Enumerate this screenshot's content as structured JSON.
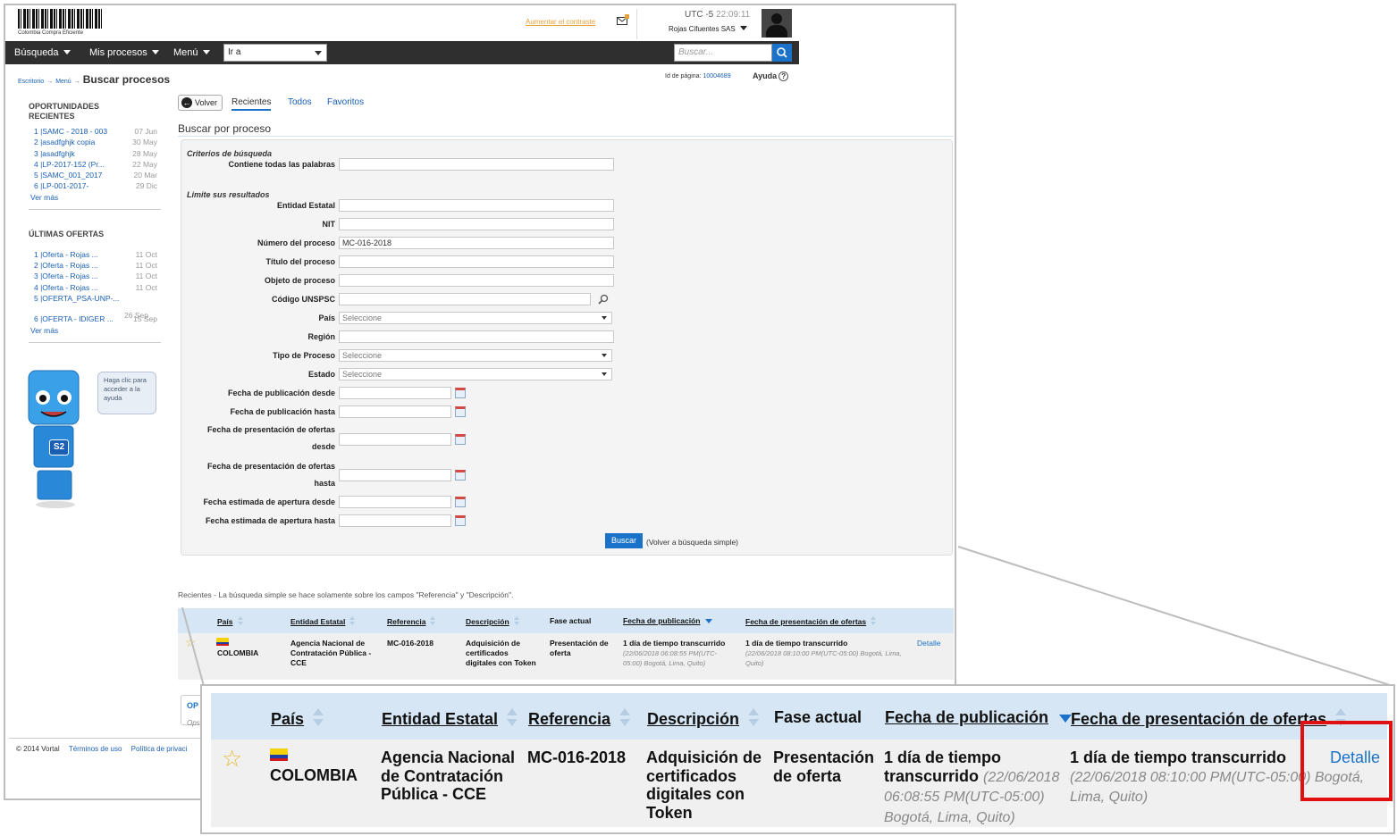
{
  "header": {
    "logo_caption": "Colombia Compra Eficiente",
    "contrast_link": "Aumentar el contraste",
    "timezone": "UTC -5",
    "time": "22:09:11",
    "company": "Rojas Cifuentes SAS"
  },
  "nav": {
    "busqueda": "Búsqueda",
    "mis_procesos": "Mis procesos",
    "menu": "Menú",
    "ir_a": "Ir a",
    "search_placeholder": "Buscar..."
  },
  "breadcrumb": {
    "escritorio": "Escritorio",
    "menu": "Menú",
    "current": "Buscar procesos",
    "page_id_label": "Id de página:",
    "page_id": "10004689",
    "help": "Ayuda",
    "help_icon": "?"
  },
  "sidebar": {
    "opportunities_title_1": "OPORTUNIDADES",
    "opportunities_title_2": "RECIENTES",
    "opportunities": [
      {
        "label": "1 |SAMC - 2018 - 003",
        "date": "07 Jun"
      },
      {
        "label": "2 |asadfghjk copia",
        "date": "30 May"
      },
      {
        "label": "3 |asadfghjk",
        "date": "28 May"
      },
      {
        "label": "4 |LP-2017-152 (Pr...",
        "date": "22 May"
      },
      {
        "label": "5 |SAMC_001_2017",
        "date": "20 Mar"
      },
      {
        "label": "6 |LP-001-2017-",
        "date": "29 Dic"
      }
    ],
    "ver_mas": "Ver más",
    "offers_title": "ÚLTIMAS OFERTAS",
    "offers": [
      {
        "label": "1 |Oferta - Rojas ...",
        "date": "11 Oct"
      },
      {
        "label": "2 |Oferta - Rojas ...",
        "date": "11 Oct"
      },
      {
        "label": "3 |Oferta - Rojas ...",
        "date": "11 Oct"
      },
      {
        "label": "4 |Oferta - Rojas ...",
        "date": "11 Oct"
      },
      {
        "label": "5 |OFERTA_PSA-UNP-...",
        "date": ""
      },
      {
        "label": "6 |OFERTA - IDIGER ...",
        "date": "15 Sep"
      }
    ],
    "offer5_date": "26 Sep",
    "help_bubble": "Haga clic para acceder a la ayuda",
    "robot_badge": "S2"
  },
  "tabs": {
    "volver": "Volver",
    "recientes": "Recientes",
    "todos": "Todos",
    "favoritos": "Favoritos"
  },
  "form": {
    "title": "Buscar por proceso",
    "criterios": "Criterios de búsqueda",
    "contiene": "Contiene todas las palabras",
    "limite": "Limite sus resultados",
    "entidad": "Entidad Estatal",
    "nit": "NIT",
    "numero": "Número del proceso",
    "numero_value": "MC-016-2018",
    "titulo": "Título del proceso",
    "objeto": "Objeto de proceso",
    "unspsc": "Código UNSPSC",
    "pais": "País",
    "pais_value": "Seleccione",
    "region": "Región",
    "tipo": "Tipo de Proceso",
    "tipo_value": "Seleccione",
    "estado": "Estado",
    "estado_value": "Seleccione",
    "pub_desde": "Fecha de publicación desde",
    "pub_hasta": "Fecha de publicación hasta",
    "pres_desde_1": "Fecha de presentación de ofertas",
    "pres_desde_2": "desde",
    "pres_hasta_1": "Fecha de presentación de ofertas",
    "pres_hasta_2": "hasta",
    "apert_desde": "Fecha estimada de apertura desde",
    "apert_hasta": "Fecha estimada de apertura hasta",
    "buscar": "Buscar",
    "volver_simple": "(Volver a búsqueda simple)"
  },
  "results": {
    "note": "Recientes - La búsqueda simple se hace solamente sobre los campos \"Referencia\" y \"Descripción\".",
    "headers": {
      "pais": "País",
      "entidad": "Entidad Estatal",
      "referencia": "Referencia",
      "descripcion": "Descripción",
      "fase": "Fase actual",
      "fecha_pub": "Fecha de publicación",
      "fecha_pres": "Fecha de presentación de ofertas"
    },
    "row": {
      "pais": "COLOMBIA",
      "entidad": "Agencia Nacional de Contratación Pública - CCE",
      "referencia": "MC-016-2018",
      "descripcion": "Adquisición de certificados digitales con Token",
      "fase": "Presentación de oferta",
      "fecha_pub_main": "1 día de tiempo transcurrido",
      "fecha_pub_detail": "(22/06/2018 06:08:55 PM(UTC-05:00) Bogotá, Lima, Quito)",
      "fecha_pres_main": "1 día de tiempo transcurrido",
      "fecha_pres_detail": "(22/06/2018 08:10:00 PM(UTC-05:00) Bogotá, Lima, Quito)",
      "detalle": "Detalle"
    }
  },
  "zoom": {
    "entidad_l1": "Agencia Nacional",
    "entidad_l2": "de Contratación",
    "entidad_l3": "Pública - CCE",
    "desc_l1": "Adquisición de",
    "desc_l2": "certificados",
    "desc_l3": "digitales con",
    "desc_l4": "Token",
    "fase_l1": "Presentación",
    "fase_l2": "de oferta",
    "pub_l1": "1 día de tiempo",
    "pub_l2": "transcurrido",
    "pub_l2b": "(22/06/2018",
    "pub_l3": "06:08:55 PM(UTC-05:00)",
    "pub_l4": "Bogotá, Lima, Quito)",
    "pres_l1": "1 día de tiempo transcurrido",
    "pres_l2": "(22/06/2018 08:10:00 PM(UTC-05:00) Bogotá,",
    "pres_l3": "Lima, Quito)"
  },
  "partial": {
    "op": "OP",
    "ops": "Ops"
  },
  "footer": {
    "copyright": "© 2014 Vortal",
    "terminos": "Términos de uso",
    "politica": "Política de privaci"
  },
  "colors": {
    "accent": "#1a73c8",
    "navbar": "#2f2f2f",
    "table_header": "#d6e6f4",
    "highlight": "#e01010"
  }
}
